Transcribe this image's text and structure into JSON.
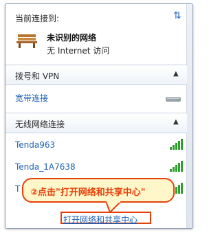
{
  "header": {
    "title": "当前连接到:"
  },
  "current_network": {
    "name": "未识别的网络",
    "status": "无 Internet 访问"
  },
  "sections": {
    "vpn": {
      "label": "拨号和 VPN"
    },
    "wireless": {
      "label": "无线网络连接"
    }
  },
  "vpn_items": [
    {
      "label": "宽带连接"
    }
  ],
  "wifi_items": [
    {
      "label": "Tenda963"
    },
    {
      "label": "Tenda_1A7638"
    },
    {
      "label": "T"
    }
  ],
  "callout": {
    "text": "②点击\"打开网络和共享中心\""
  },
  "footer": {
    "link": "打开网络和共享中心"
  },
  "colors": {
    "link": "#1a5fb4",
    "callout_border": "#e5400a",
    "callout_bg": "#fff7c9",
    "signal": "#2ea02e"
  }
}
